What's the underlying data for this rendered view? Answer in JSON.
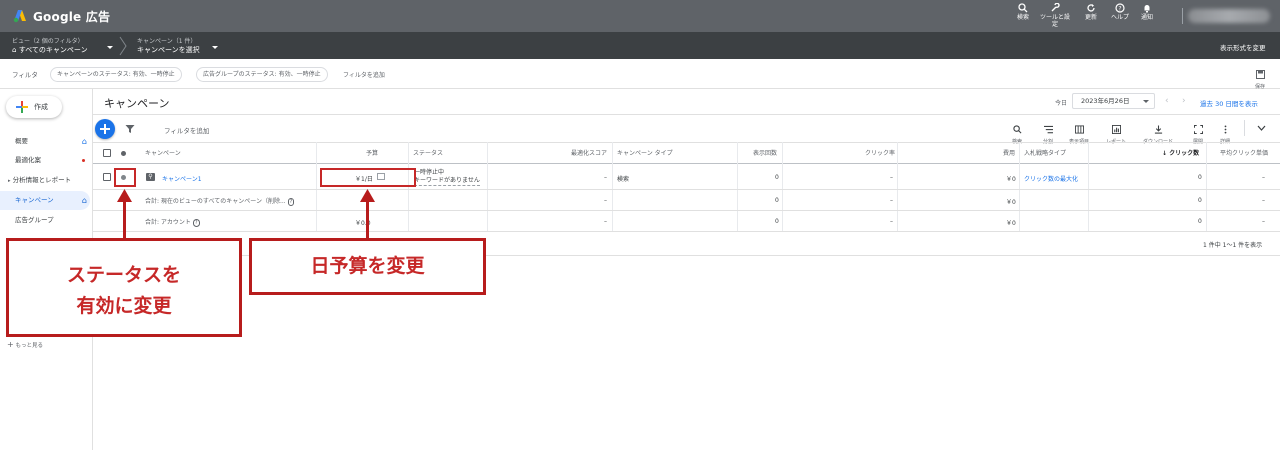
{
  "topbar": {
    "brand": "Google 広告",
    "tools": [
      {
        "icon": "search-icon",
        "label": "検索"
      },
      {
        "icon": "wrench-icon",
        "label": "ツールと設定"
      },
      {
        "icon": "refresh-icon",
        "label": "更新"
      },
      {
        "icon": "help-icon",
        "label": "ヘルプ"
      },
      {
        "icon": "bell-icon",
        "label": "通知"
      }
    ]
  },
  "navbar": {
    "view_small": "ビュー（2 個のフィルタ）",
    "view_main": "すべてのキャンペーン",
    "campaign_small": "キャンペーン（1 件）",
    "campaign_main": "キャンペーンを選択",
    "display_format": "表示形式を変更"
  },
  "filters": {
    "label": "フィルタ",
    "chips": [
      "キャンペーンのステータス: 有効、一時停止",
      "広告グループのステータス: 有効、一時停止"
    ],
    "add": "フィルタを追加",
    "save": "保存"
  },
  "sidebar": {
    "create": "作成",
    "items": [
      "概要",
      "最適化案",
      "分析情報とレポート",
      "キャンペーン",
      "広告グループ"
    ],
    "more": "もっと見る"
  },
  "main": {
    "title": "キャンペーン",
    "today_label": "今日",
    "date": "2023年6月26日",
    "range": "過去 30 日間を表示",
    "add_filter": "フィルタを追加",
    "toolbar": [
      "検索",
      "分割",
      "表示項目",
      "レポート",
      "ダウンロード",
      "展開",
      "詳細"
    ]
  },
  "table": {
    "headers": {
      "campaign": "キャンペーン",
      "budget": "予算",
      "status": "ステータス",
      "opt_score": "最適化スコア",
      "campaign_type": "キャンペーン タイプ",
      "impressions": "表示回数",
      "ctr": "クリック率",
      "cost": "費用",
      "bidding": "入札戦略タイプ",
      "clicks": "クリック数",
      "avg_cpc": "平均クリック単価"
    },
    "row1": {
      "campaign": "キャンペーン1",
      "budget": "￥1/日",
      "status_line1": "一時停止中",
      "status_line2": "キーワードがありません",
      "opt_score": "–",
      "campaign_type": "検索",
      "impressions": "0",
      "ctr": "–",
      "cost": "￥0",
      "bidding": "クリック数の最大化",
      "clicks": "0",
      "avg_cpc": "–"
    },
    "row2": {
      "label": "合計: 現在のビューのすべてのキャンペーン（削除...",
      "opt_score": "–",
      "impressions": "0",
      "ctr": "–",
      "cost": "￥0",
      "clicks": "0",
      "avg_cpc": "–"
    },
    "row3": {
      "label": "合計: アカウント",
      "budget": "￥0.0",
      "opt_score": "–",
      "impressions": "0",
      "ctr": "–",
      "cost": "￥0",
      "clicks": "0",
      "avg_cpc": "–"
    },
    "pagination": "1 件中 1～1 件を表示"
  },
  "annotations": {
    "status_line1": "ステータスを",
    "status_line2": "有効に変更",
    "budget": "日予算を変更"
  },
  "colors": {
    "topbar": "#5f6368",
    "navbar": "#3c4043",
    "accent": "#1a73e8",
    "annotation_red": "#c62828"
  }
}
